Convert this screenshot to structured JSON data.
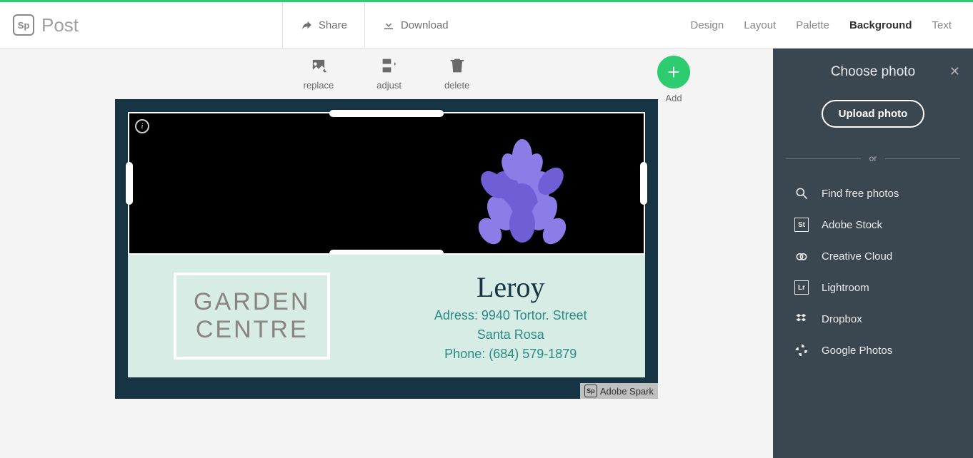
{
  "header": {
    "logo_badge": "Sp",
    "logo_text": "Post",
    "share": "Share",
    "download": "Download",
    "tabs": {
      "design": "Design",
      "layout": "Layout",
      "palette": "Palette",
      "background": "Background",
      "text": "Text"
    }
  },
  "tools": {
    "replace": "replace",
    "adjust": "adjust",
    "delete": "delete",
    "add": "Add"
  },
  "card": {
    "box_line1": "GARDEN",
    "box_line2": "CENTRE",
    "name": "Leroy",
    "address": "Adress: 9940 Tortor. Street",
    "city": "Santa Rosa",
    "phone": "Phone: (684) 579-1879",
    "watermark": "Adobe Spark",
    "watermark_badge": "Sp"
  },
  "sidebar": {
    "title": "Choose photo",
    "upload": "Upload photo",
    "or": "or",
    "sources": {
      "find": "Find free photos",
      "stock": "Adobe Stock",
      "cc": "Creative Cloud",
      "lr": "Lightroom",
      "dropbox": "Dropbox",
      "gphotos": "Google Photos"
    },
    "stock_badge": "St",
    "lr_badge": "Lr"
  },
  "colors": {
    "accent": "#2ecc71",
    "sidebar_bg": "#3a4750",
    "card_bg": "#163443"
  }
}
